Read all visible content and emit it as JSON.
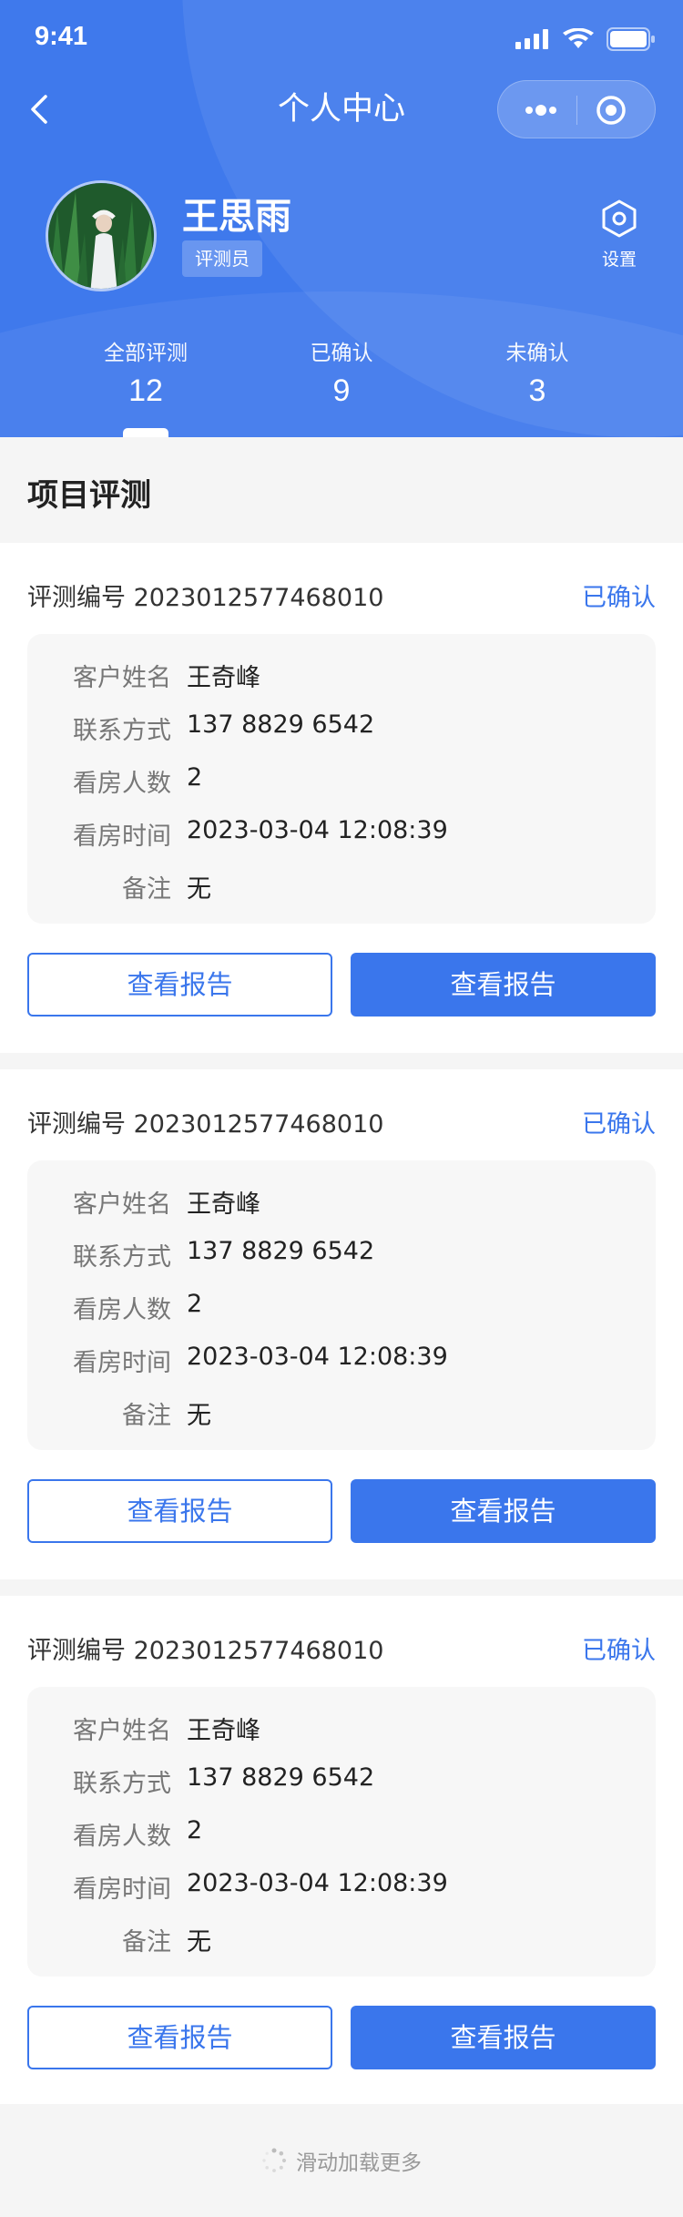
{
  "status_bar": {
    "time": "9:41"
  },
  "nav": {
    "title": "个人中心"
  },
  "profile": {
    "name": "王思雨",
    "role": "评测员",
    "settings_label": "设置"
  },
  "stats": [
    {
      "label": "全部评测",
      "value": "12"
    },
    {
      "label": "已确认",
      "value": "9"
    },
    {
      "label": "未确认",
      "value": "3"
    }
  ],
  "section": {
    "title": "项目评测"
  },
  "labels": {
    "customer_name": "客户姓名",
    "contact": "联系方式",
    "viewers": "看房人数",
    "visit_time": "看房时间",
    "remark": "备注"
  },
  "cards": [
    {
      "code": "评测编号 2023012577468010",
      "status": "已确认",
      "customer_name": "王奇峰",
      "contact": "137 8829 6542",
      "viewers": "2",
      "visit_time": "2023-03-04 12:08:39",
      "remark": "无",
      "btn_left": "查看报告",
      "btn_right": "查看报告"
    },
    {
      "code": "评测编号 2023012577468010",
      "status": "已确认",
      "customer_name": "王奇峰",
      "contact": "137 8829 6542",
      "viewers": "2",
      "visit_time": "2023-03-04 12:08:39",
      "remark": "无",
      "btn_left": "查看报告",
      "btn_right": "查看报告"
    },
    {
      "code": "评测编号 2023012577468010",
      "status": "已确认",
      "customer_name": "王奇峰",
      "contact": "137 8829 6542",
      "viewers": "2",
      "visit_time": "2023-03-04 12:08:39",
      "remark": "无",
      "btn_left": "查看报告",
      "btn_right": "查看报告"
    }
  ],
  "footer": {
    "load_more": "滑动加载更多"
  },
  "colors": {
    "primary": "#3f79ec",
    "accent": "#3a76ec",
    "background": "#f5f5f5"
  }
}
